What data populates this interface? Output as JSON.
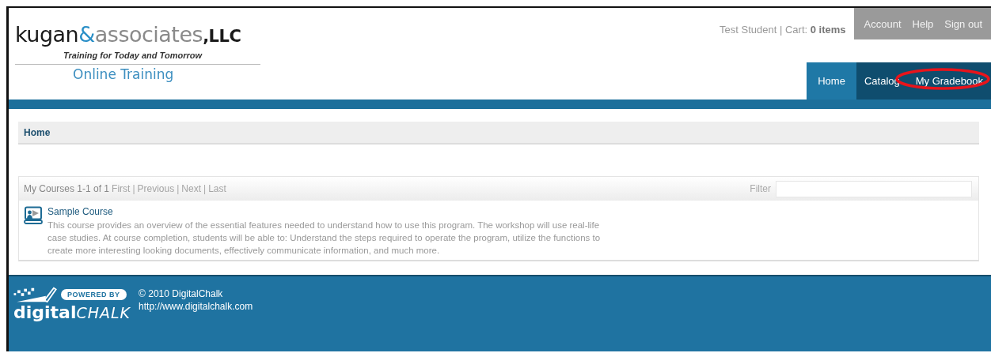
{
  "logo": {
    "word_1": "kugan",
    "ampersand": "&",
    "word_2": "associates",
    "suffix": ",LLC",
    "tagline": "Training for Today and Tomorrow",
    "subtitle": "Online Training"
  },
  "user_bar": "Test Student | Cart: **0 items**",
  "account_links": [
    "Account",
    "Help",
    "Sign out"
  ],
  "nav_tabs": [
    {
      "label": "Home",
      "selected": true,
      "circled": false
    },
    {
      "label": "Catalog",
      "selected": false,
      "circled": false
    },
    {
      "label": "My Gradebook",
      "selected": false,
      "circled": true
    }
  ],
  "breadcrumb": "Home",
  "courses": {
    "title": "My Courses 1-1 of 1",
    "separator": "|",
    "pager": [
      {
        "label": "First",
        "disabled": true
      },
      {
        "label": "Previous",
        "disabled": true
      },
      {
        "label": "Next",
        "disabled": true
      },
      {
        "label": "Last",
        "disabled": true
      }
    ],
    "filter_label": "Filter",
    "items": [
      {
        "title": "Sample Course",
        "description": "This course provides an overview of the essential features needed to understand how to use this program. The workshop will use real-life case studies. At course completion, students will be able to: Understand the steps required to operate the program, utilize the functions to create more interesting looking documents, effectively communicate information, and much more."
      }
    ]
  },
  "footer": {
    "powered_by": "POWERED BY",
    "brand_1": "digital",
    "brand_2": "CHALK",
    "copyright": "© 2010 DigitalChalk",
    "url": "http://www.digitalchalk.com"
  }
}
